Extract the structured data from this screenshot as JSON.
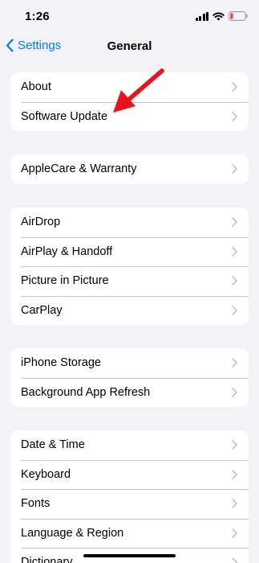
{
  "status_bar": {
    "time": "1:26",
    "icons": [
      "signal-icon",
      "wifi-icon",
      "battery-low-icon"
    ],
    "battery_color": "#ff3b30"
  },
  "nav": {
    "back_label": "Settings",
    "back_icon": "chevron-left-icon",
    "title": "General",
    "accent_color": "#007aff"
  },
  "groups": [
    {
      "items": [
        {
          "label": "About"
        },
        {
          "label": "Software Update"
        }
      ]
    },
    {
      "items": [
        {
          "label": "AppleCare & Warranty"
        }
      ]
    },
    {
      "items": [
        {
          "label": "AirDrop"
        },
        {
          "label": "AirPlay & Handoff"
        },
        {
          "label": "Picture in Picture"
        },
        {
          "label": "CarPlay"
        }
      ]
    },
    {
      "items": [
        {
          "label": "iPhone Storage"
        },
        {
          "label": "Background App Refresh"
        }
      ]
    },
    {
      "items": [
        {
          "label": "Date & Time"
        },
        {
          "label": "Keyboard"
        },
        {
          "label": "Fonts"
        },
        {
          "label": "Language & Region"
        },
        {
          "label": "Dictionary"
        }
      ]
    }
  ],
  "annotation": {
    "type": "red-arrow",
    "points_to": "Software Update",
    "color": "#e8141b"
  }
}
